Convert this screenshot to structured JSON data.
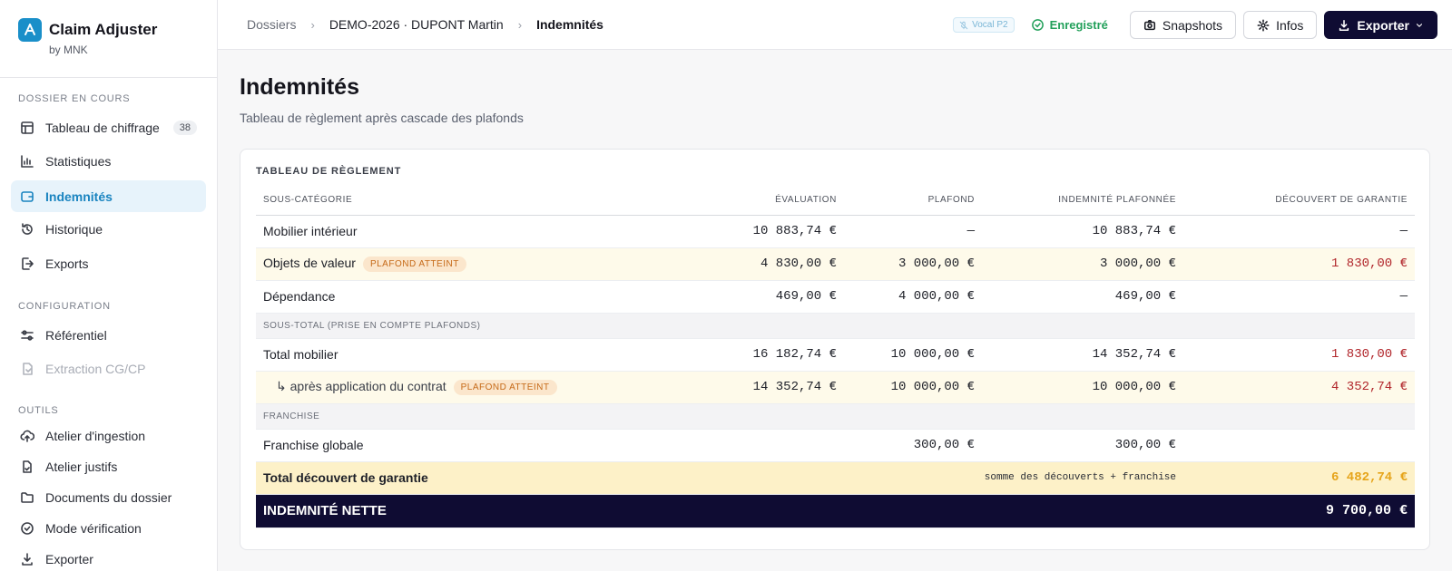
{
  "brand": {
    "title": "Claim Adjuster",
    "subtitle": "by MNK",
    "logo_letter": "A"
  },
  "sidebar": {
    "sections": [
      {
        "label": "DOSSIER EN COURS"
      },
      {
        "label": "CONFIGURATION"
      },
      {
        "label": "OUTILS"
      }
    ],
    "items": [
      {
        "label": "Tableau de chiffrage",
        "badge": "38",
        "icon": "table-icon"
      },
      {
        "label": "Statistiques",
        "icon": "bar-chart-icon"
      },
      {
        "label": "Indemnités",
        "icon": "wallet-icon",
        "active": true
      },
      {
        "label": "Historique",
        "icon": "history-icon"
      },
      {
        "label": "Exports",
        "icon": "export-icon"
      },
      {
        "label": "Référentiel",
        "icon": "sliders-icon"
      },
      {
        "label": "Extraction CG/CP",
        "icon": "document-extract-icon",
        "disabled": true
      },
      {
        "label": "Atelier d'ingestion",
        "icon": "cloud-upload-icon"
      },
      {
        "label": "Atelier justifs",
        "icon": "file-check-icon"
      },
      {
        "label": "Documents du dossier",
        "icon": "folder-icon"
      },
      {
        "label": "Mode vérification",
        "icon": "check-circle-icon"
      },
      {
        "label": "Exporter",
        "icon": "download-icon"
      }
    ]
  },
  "breadcrumb": {
    "root": "Dossiers",
    "dossier": "DEMO-2026 · DUPONT Martin",
    "current": "Indemnités"
  },
  "header": {
    "vocal_label": "Vocal P2",
    "saved_label": "Enregistré",
    "snapshots_label": "Snapshots",
    "infos_label": "Infos",
    "export_label": "Exporter"
  },
  "page": {
    "title": "Indemnités",
    "subtitle": "Tableau de règlement après cascade des plafonds"
  },
  "table": {
    "title": "TABLEAU DE RÈGLEMENT",
    "columns": [
      "SOUS-CATÉGORIE",
      "ÉVALUATION",
      "PLAFOND",
      "INDEMNITÉ PLAFONNÉE",
      "DÉCOUVERT DE GARANTIE"
    ],
    "rows": [
      {
        "label": "Mobilier intérieur",
        "evaluation": "10 883,74 €",
        "plafond": "—",
        "indemnite": "10 883,74 €",
        "decouvert": "—"
      },
      {
        "label": "Objets de valeur",
        "tag": "PLAFOND ATTEINT",
        "evaluation": "4 830,00 €",
        "plafond": "3 000,00 €",
        "indemnite": "3 000,00 €",
        "decouvert": "1 830,00 €"
      },
      {
        "label": "Dépendance",
        "evaluation": "469,00 €",
        "plafond": "4 000,00 €",
        "indemnite": "469,00 €",
        "decouvert": "—"
      }
    ],
    "subtotal_group": "SOUS-TOTAL (PRISE EN COMPTE PLAFONDS)",
    "total_mobilier": {
      "label": "Total mobilier",
      "evaluation": "16 182,74 €",
      "plafond": "10 000,00 €",
      "indemnite": "14 352,74 €",
      "decouvert": "1 830,00 €"
    },
    "after_contract": {
      "label": "↳ après application du contrat",
      "tag": "PLAFOND ATTEINT",
      "evaluation": "14 352,74 €",
      "plafond": "10 000,00 €",
      "indemnite": "10 000,00 €",
      "decouvert": "4 352,74 €"
    },
    "franchise_group": "FRANCHISE",
    "franchise": {
      "label": "Franchise globale",
      "plafond": "300,00 €",
      "indemnite": "300,00 €"
    },
    "total_decouvert": {
      "label": "Total découvert de garantie",
      "note": "somme des découverts + franchise",
      "value": "6 482,74 €"
    },
    "net": {
      "label": "INDEMNITÉ NETTE",
      "value": "9 700,00 €"
    }
  },
  "colors": {
    "accent": "#1a84c0",
    "dark": "#0f0c33",
    "danger": "#b1262b",
    "warning": "#e6a41a",
    "success": "#22a05a"
  }
}
